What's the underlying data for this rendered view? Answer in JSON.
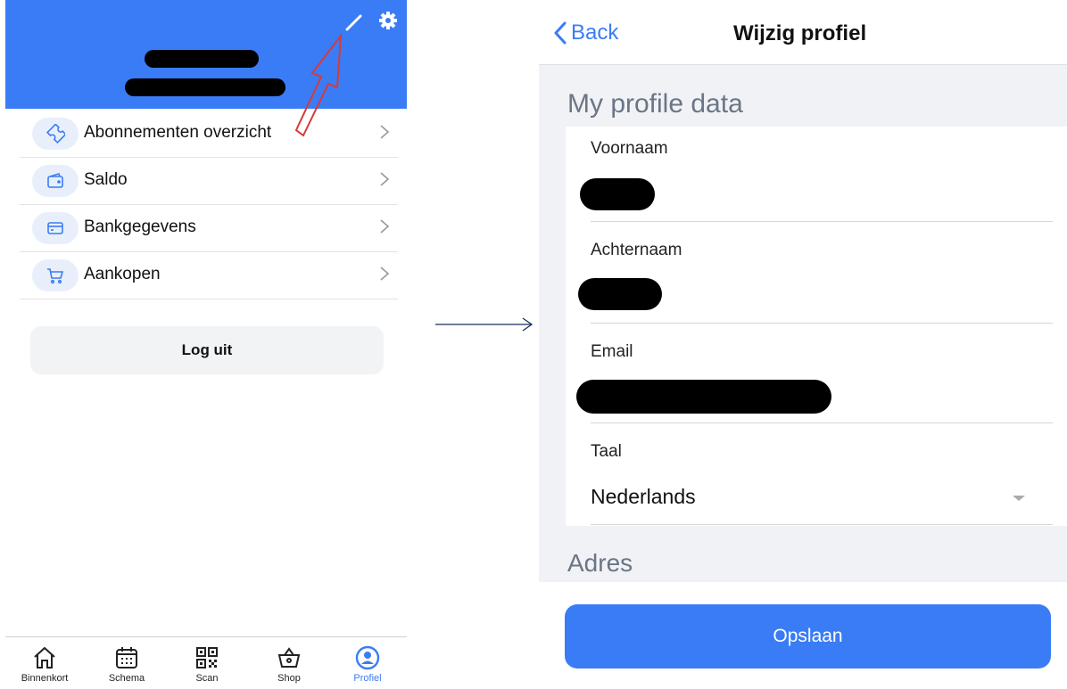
{
  "left_screen": {
    "menu": [
      {
        "label": "Abonnementen overzicht",
        "icon": "ticket-icon"
      },
      {
        "label": "Saldo",
        "icon": "wallet-icon"
      },
      {
        "label": "Bankgegevens",
        "icon": "card-icon"
      },
      {
        "label": "Aankopen",
        "icon": "cart-icon"
      }
    ],
    "logout_label": "Log uit",
    "tabs": [
      {
        "label": "Binnenkort",
        "icon": "home-icon"
      },
      {
        "label": "Schema",
        "icon": "calendar-icon"
      },
      {
        "label": "Scan",
        "icon": "qr-icon"
      },
      {
        "label": "Shop",
        "icon": "basket-icon"
      },
      {
        "label": "Profiel",
        "icon": "profile-icon",
        "active": true
      }
    ],
    "colors": {
      "header": "#3a7cf5",
      "accent": "#3a7cf5",
      "annotation_arrow": "#d63a3a"
    }
  },
  "right_screen": {
    "back_label": "Back",
    "title": "Wijzig profiel",
    "section_profile": "My profile data",
    "fields": {
      "first_name_label": "Voornaam",
      "last_name_label": "Achternaam",
      "email_label": "Email",
      "language_label": "Taal",
      "language_value": "Nederlands"
    },
    "section_address": "Adres",
    "save_label": "Opslaan"
  }
}
